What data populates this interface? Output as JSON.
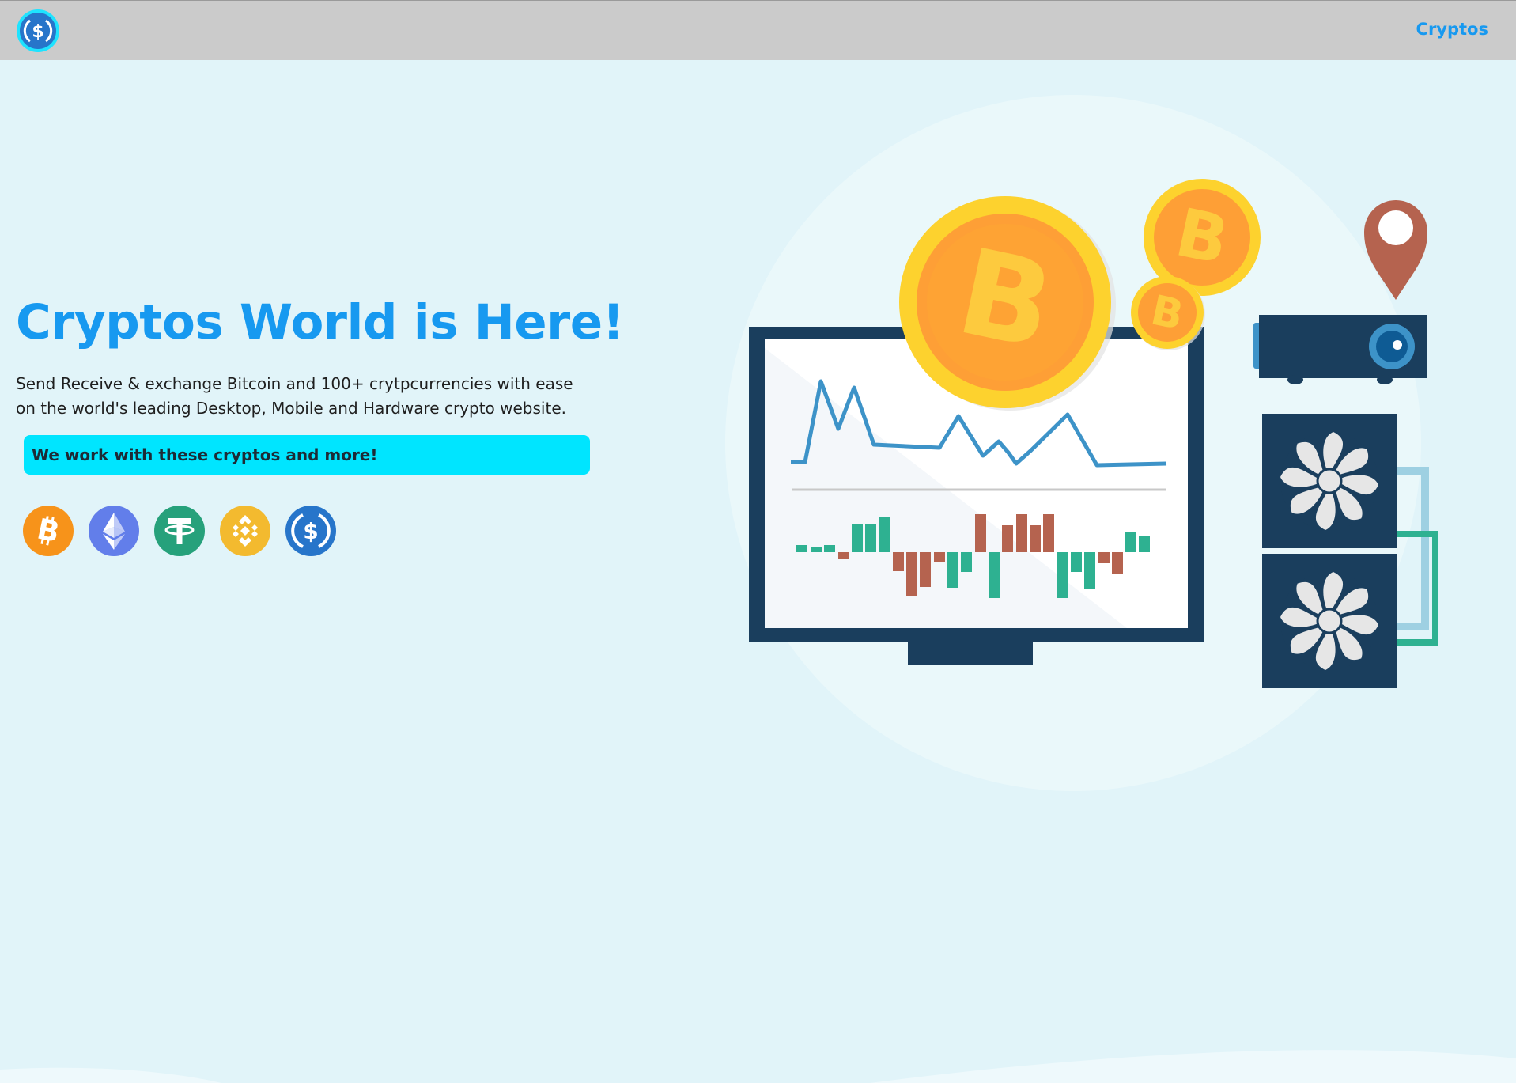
{
  "nav": {
    "logo_icon": "usd-coin-logo-icon",
    "link_label": "Cryptos"
  },
  "hero": {
    "title": "Cryptos World is Here!",
    "description_line1": "Send Receive & exchange Bitcoin and 100+ crytpcurrencies with ease",
    "description_line2": "on the world's leading Desktop, Mobile and Hardware crypto website.",
    "callout": "We work with these cryptos and more!"
  },
  "coins": [
    {
      "icon": "bitcoin-icon",
      "color": "#f7931a"
    },
    {
      "icon": "ethereum-icon",
      "color": "#627eea"
    },
    {
      "icon": "tether-icon",
      "color": "#26a17b"
    },
    {
      "icon": "bnb-icon",
      "color": "#f3ba2f"
    },
    {
      "icon": "usd-coin-icon",
      "color": "#2775ca"
    }
  ],
  "colors": {
    "background": "#e1f4f9",
    "navbar": "#cbcbcb",
    "accent": "#1799f0",
    "callout": "#00e5ff"
  }
}
